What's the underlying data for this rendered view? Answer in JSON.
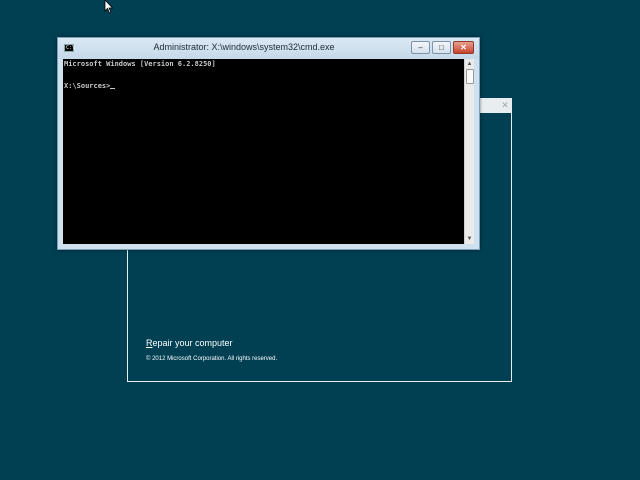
{
  "setup": {
    "repair_prefix": "R",
    "repair_rest": "epair your computer",
    "copyright": "© 2012 Microsoft Corporation. All rights reserved.",
    "close_glyph": "✕"
  },
  "cmd": {
    "icon_text": "C:\\",
    "title": "Administrator: X:\\windows\\system32\\cmd.exe",
    "min_glyph": "–",
    "max_glyph": "□",
    "close_glyph": "✕",
    "lines": [
      "Microsoft Windows [Version 6.2.8250]",
      "",
      "X:\\Sources>"
    ],
    "scroll_up_glyph": "▲",
    "scroll_down_glyph": "▼"
  },
  "colors": {
    "desktop": "#013f53",
    "console_bg": "#000000",
    "console_text": "#c8c8c8",
    "titlebar": "#cfe0ee",
    "close_button": "#c7432b"
  },
  "icons": [
    "cmd-icon",
    "minimize-icon",
    "maximize-icon",
    "close-icon",
    "mouse-pointer-icon",
    "scroll-up-icon",
    "scroll-down-icon"
  ]
}
